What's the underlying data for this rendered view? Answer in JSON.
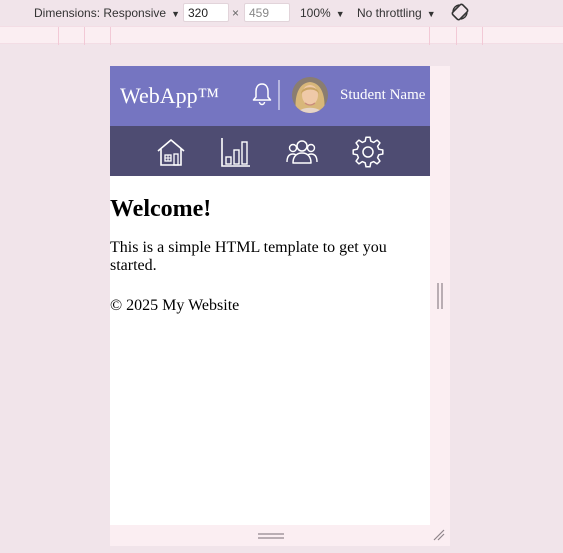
{
  "devtools": {
    "dimensions_label": "Dimensions: Responsive",
    "width": "320",
    "height": "459",
    "times": "×",
    "zoom": "100%",
    "throttling": "No throttling",
    "rotate_icon": "rotate-icon"
  },
  "app": {
    "brand": "WebApp™",
    "user_name": "Student Name",
    "header_color": "#7575c1",
    "nav_color": "#4e4c72",
    "nav_items": [
      {
        "icon": "home-icon"
      },
      {
        "icon": "bar-chart-icon"
      },
      {
        "icon": "users-icon"
      },
      {
        "icon": "settings-icon"
      }
    ]
  },
  "main": {
    "heading": "Welcome!",
    "intro": "This is a simple HTML template to get you started."
  },
  "footer": {
    "text": "© 2025 My Website"
  }
}
